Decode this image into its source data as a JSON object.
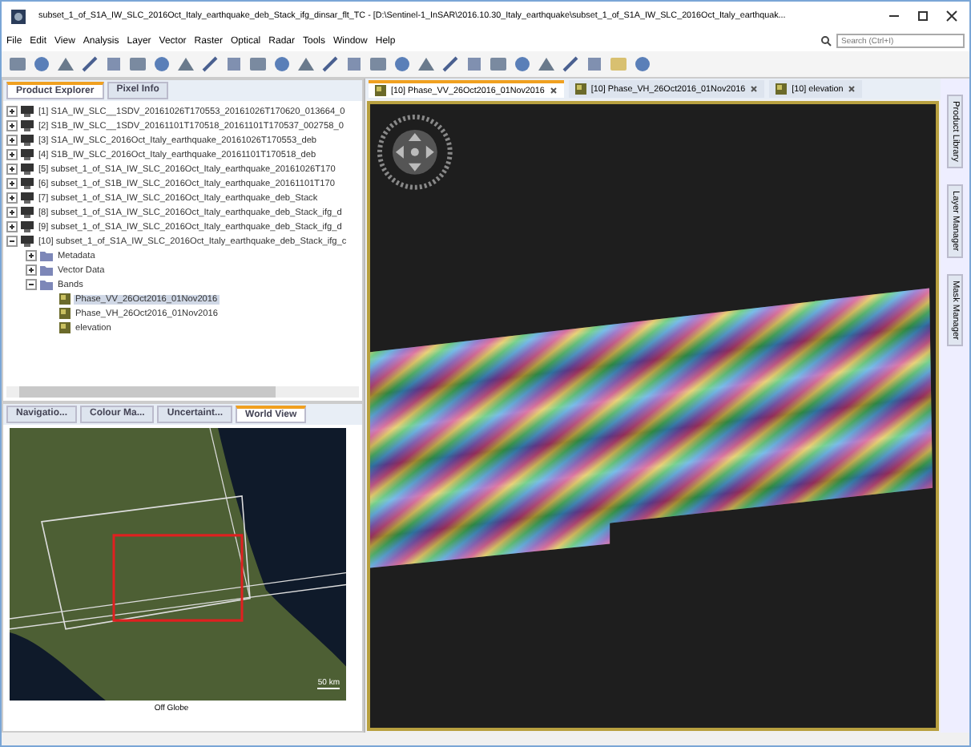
{
  "window": {
    "title": "subset_1_of_S1A_IW_SLC_2016Oct_Italy_earthquake_deb_Stack_ifg_dinsar_flt_TC - [D:\\Sentinel-1_InSAR\\2016.10.30_Italy_earthquake\\subset_1_of_S1A_IW_SLC_2016Oct_Italy_earthquak..."
  },
  "menu": [
    "File",
    "Edit",
    "View",
    "Analysis",
    "Layer",
    "Vector",
    "Raster",
    "Optical",
    "Radar",
    "Tools",
    "Window",
    "Help"
  ],
  "search": {
    "placeholder": "Search (Ctrl+I)"
  },
  "left_tabs": [
    {
      "label": "Product Explorer",
      "selected": true
    },
    {
      "label": "Pixel Info",
      "selected": false
    }
  ],
  "products": [
    {
      "label": "[1] S1A_IW_SLC__1SDV_20161026T170553_20161026T170620_013664_0",
      "expanded": false
    },
    {
      "label": "[2] S1B_IW_SLC__1SDV_20161101T170518_20161101T170537_002758_0",
      "expanded": false
    },
    {
      "label": "[3] S1A_IW_SLC_2016Oct_Italy_earthquake_20161026T170553_deb",
      "expanded": false
    },
    {
      "label": "[4] S1B_IW_SLC_2016Oct_Italy_earthquake_20161101T170518_deb",
      "expanded": false
    },
    {
      "label": "[5] subset_1_of_S1A_IW_SLC_2016Oct_Italy_earthquake_20161026T170",
      "expanded": false
    },
    {
      "label": "[6] subset_1_of_S1B_IW_SLC_2016Oct_Italy_earthquake_20161101T170",
      "expanded": false
    },
    {
      "label": "[7] subset_1_of_S1A_IW_SLC_2016Oct_Italy_earthquake_deb_Stack",
      "expanded": false
    },
    {
      "label": "[8] subset_1_of_S1A_IW_SLC_2016Oct_Italy_earthquake_deb_Stack_ifg_d",
      "expanded": false
    },
    {
      "label": "[9] subset_1_of_S1A_IW_SLC_2016Oct_Italy_earthquake_deb_Stack_ifg_d",
      "expanded": false
    },
    {
      "label": "[10] subset_1_of_S1A_IW_SLC_2016Oct_Italy_earthquake_deb_Stack_ifg_c",
      "expanded": true,
      "children": [
        {
          "label": "Metadata",
          "expanded": false
        },
        {
          "label": "Vector Data",
          "expanded": false
        },
        {
          "label": "Bands",
          "expanded": true,
          "children": [
            {
              "label": "Phase_VV_26Oct2016_01Nov2016",
              "selected": true
            },
            {
              "label": "Phase_VH_26Oct2016_01Nov2016",
              "selected": false
            },
            {
              "label": "elevation",
              "selected": false
            }
          ]
        }
      ]
    }
  ],
  "bottom_tabs": [
    {
      "label": "Navigatio...",
      "selected": false
    },
    {
      "label": "Colour Ma...",
      "selected": false
    },
    {
      "label": "Uncertaint...",
      "selected": false
    },
    {
      "label": "World View",
      "selected": true
    }
  ],
  "world_view": {
    "scale": "50 km",
    "status": "Off Globe"
  },
  "image_tabs": [
    {
      "label": "[10] Phase_VV_26Oct2016_01Nov2016",
      "selected": true
    },
    {
      "label": "[10] Phase_VH_26Oct2016_01Nov2016",
      "selected": false
    },
    {
      "label": "[10] elevation",
      "selected": false
    }
  ],
  "side_tabs": [
    "Product Library",
    "Layer Manager",
    "Mask Manager"
  ]
}
